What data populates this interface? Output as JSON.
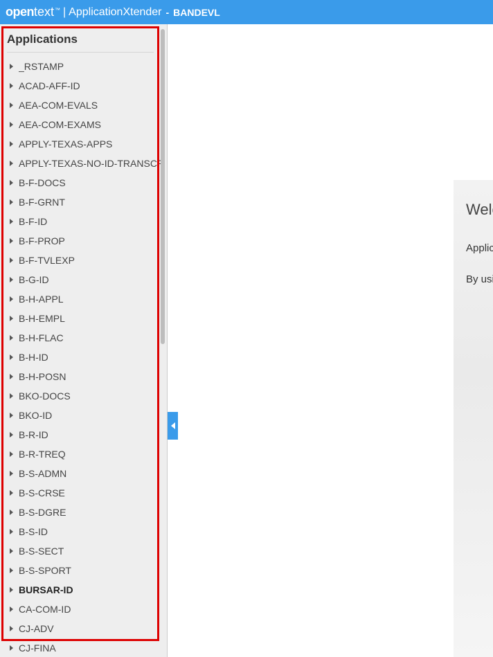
{
  "header": {
    "brand_bold": "open",
    "brand_light": "text",
    "tm": "™",
    "separator": "|",
    "app_name": "ApplicationXtender",
    "dash": "-",
    "env": "BANDEVL"
  },
  "sidebar": {
    "title": "Applications",
    "items": [
      {
        "label": "_RSTAMP",
        "bold": false
      },
      {
        "label": "ACAD-AFF-ID",
        "bold": false
      },
      {
        "label": "AEA-COM-EVALS",
        "bold": false
      },
      {
        "label": "AEA-COM-EXAMS",
        "bold": false
      },
      {
        "label": "APPLY-TEXAS-APPS",
        "bold": false
      },
      {
        "label": "APPLY-TEXAS-NO-ID-TRANSCRIPTS",
        "bold": false
      },
      {
        "label": "B-F-DOCS",
        "bold": false
      },
      {
        "label": "B-F-GRNT",
        "bold": false
      },
      {
        "label": "B-F-ID",
        "bold": false
      },
      {
        "label": "B-F-PROP",
        "bold": false
      },
      {
        "label": "B-F-TVLEXP",
        "bold": false
      },
      {
        "label": "B-G-ID",
        "bold": false
      },
      {
        "label": "B-H-APPL",
        "bold": false
      },
      {
        "label": "B-H-EMPL",
        "bold": false
      },
      {
        "label": "B-H-FLAC",
        "bold": false
      },
      {
        "label": "B-H-ID",
        "bold": false
      },
      {
        "label": "B-H-POSN",
        "bold": false
      },
      {
        "label": "BKO-DOCS",
        "bold": false
      },
      {
        "label": "BKO-ID",
        "bold": false
      },
      {
        "label": "B-R-ID",
        "bold": false
      },
      {
        "label": "B-R-TREQ",
        "bold": false
      },
      {
        "label": "B-S-ADMN",
        "bold": false
      },
      {
        "label": "B-S-CRSE",
        "bold": false
      },
      {
        "label": "B-S-DGRE",
        "bold": false
      },
      {
        "label": "B-S-ID",
        "bold": false
      },
      {
        "label": "B-S-SECT",
        "bold": false
      },
      {
        "label": "B-S-SPORT",
        "bold": false
      },
      {
        "label": "BURSAR-ID",
        "bold": true
      },
      {
        "label": "CA-COM-ID",
        "bold": false
      },
      {
        "label": "CJ-ADV",
        "bold": false
      },
      {
        "label": "CJ-FINA",
        "bold": false
      }
    ]
  },
  "main": {
    "welcome_title": "Welcome",
    "line1": "Application",
    "line2": "By using"
  }
}
